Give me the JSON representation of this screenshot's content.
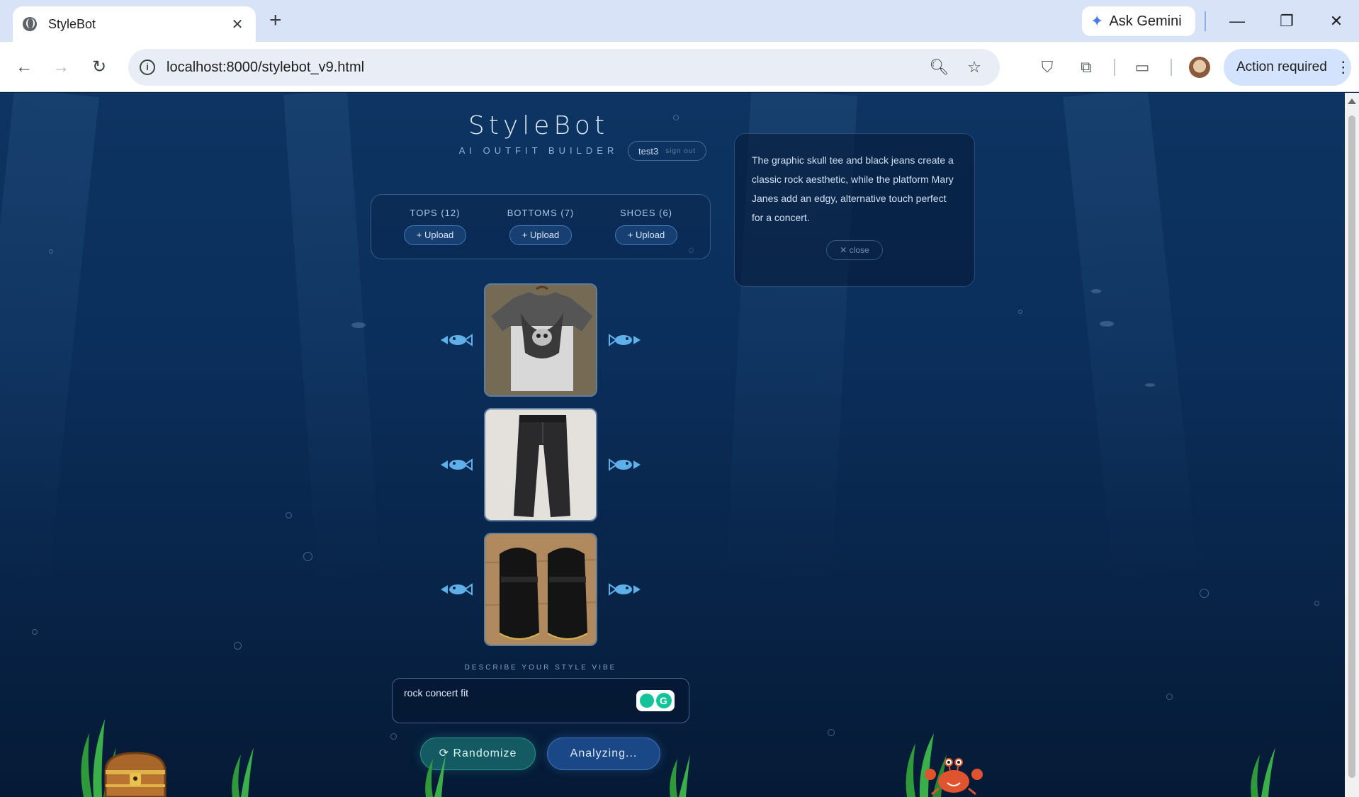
{
  "browser": {
    "tab_title": "StyleBot",
    "tab_close": "✕",
    "new_tab": "+",
    "gemini_label": "Ask Gemini",
    "url_host": "localhost",
    "url_path": ":8000/stylebot_v9.html",
    "action_label": "Action required"
  },
  "app": {
    "title": "StyleBot",
    "subtitle": "AI OUTFIT BUILDER",
    "user": {
      "name": "test3",
      "sign_out": "sign out"
    }
  },
  "categories": [
    {
      "label": "TOPS (12)",
      "upload": "+ Upload"
    },
    {
      "label": "BOTTOMS (7)",
      "upload": "+ Upload"
    },
    {
      "label": "SHOES (6)",
      "upload": "+ Upload"
    }
  ],
  "explanation": {
    "text": "The graphic skull tee and black jeans create a classic rock aesthetic, while the platform Mary Janes add an edgy, alternative touch perfect for a concert.",
    "close": "✕ close"
  },
  "outfit": [
    {
      "item": "graphic skull tee"
    },
    {
      "item": "black jeans"
    },
    {
      "item": "platform Mary Janes"
    }
  ],
  "vibe": {
    "label": "DESCRIBE YOUR STYLE VIBE",
    "value": "rock concert fit"
  },
  "actions": {
    "randomize": "⟳ Randomize",
    "analyze": "Analyzing..."
  },
  "colors": {
    "ocean_top": "#0d3462",
    "ocean_bottom": "#051a35",
    "fish": "#5fb0e8",
    "upload_button": "#173f72",
    "randomize_button": "#145a63",
    "analyze_button": "#1a4785"
  }
}
